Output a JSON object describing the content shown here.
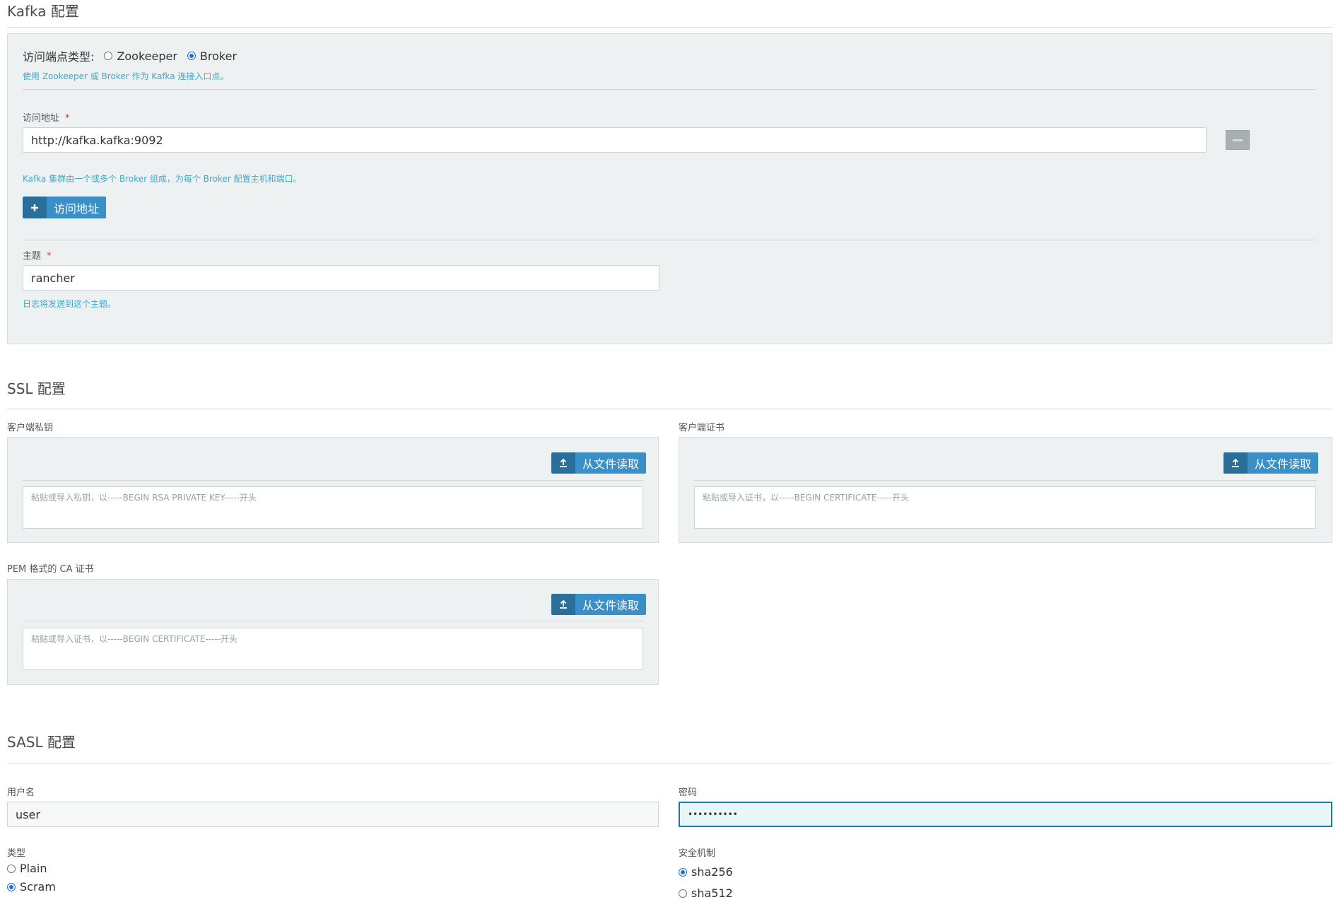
{
  "kafka": {
    "title": "Kafka 配置",
    "endpoint_type_label": "访问端点类型:",
    "endpoint_options": [
      {
        "label": "Zookeeper",
        "selected": false
      },
      {
        "label": "Broker",
        "selected": true
      }
    ],
    "endpoint_help": "使用 Zookeeper 或 Broker 作为 Kafka 连接入口点。",
    "address_label": "访问地址",
    "required_mark": "*",
    "address_value": "http://kafka.kafka:9092",
    "address_help": "Kafka 集群由一个或多个 Broker 组成，为每个 Broker 配置主机和端口。",
    "add_address_button": "访问地址",
    "topic_label": "主题",
    "topic_value": "rancher",
    "topic_help": "日志将发送到这个主题。"
  },
  "ssl": {
    "title": "SSL 配置",
    "client_key_label": "客户端私钥",
    "client_key_placeholder": "粘贴或导入私钥，以-----BEGIN RSA PRIVATE KEY-----开头",
    "client_cert_label": "客户端证书",
    "client_cert_placeholder": "粘贴或导入证书，以-----BEGIN CERTIFICATE-----开头",
    "ca_cert_label": "PEM 格式的 CA 证书",
    "ca_cert_placeholder": "粘贴或导入证书，以-----BEGIN CERTIFICATE-----开头",
    "read_from_file_button": "从文件读取"
  },
  "sasl": {
    "title": "SASL 配置",
    "username_label": "用户名",
    "username_value": "user",
    "password_label": "密码",
    "password_value": "••••••••••",
    "type_label": "类型",
    "type_options": [
      {
        "label": "Plain",
        "selected": false
      },
      {
        "label": "Scram",
        "selected": true
      }
    ],
    "mechanism_label": "安全机制",
    "mechanism_options": [
      {
        "label": "sha256",
        "selected": true
      },
      {
        "label": "sha512",
        "selected": false
      }
    ]
  },
  "icons": {
    "plus": "plus-icon",
    "upload": "upload-icon",
    "minus": "minus-icon"
  },
  "colors": {
    "help_text": "#3fa9c9",
    "button_primary": "#3a8fc7",
    "button_icon_bg": "#2a6e9a",
    "panel_bg": "#eef1f2",
    "focus_border": "#1f7a9c",
    "required": "#dd3333"
  }
}
